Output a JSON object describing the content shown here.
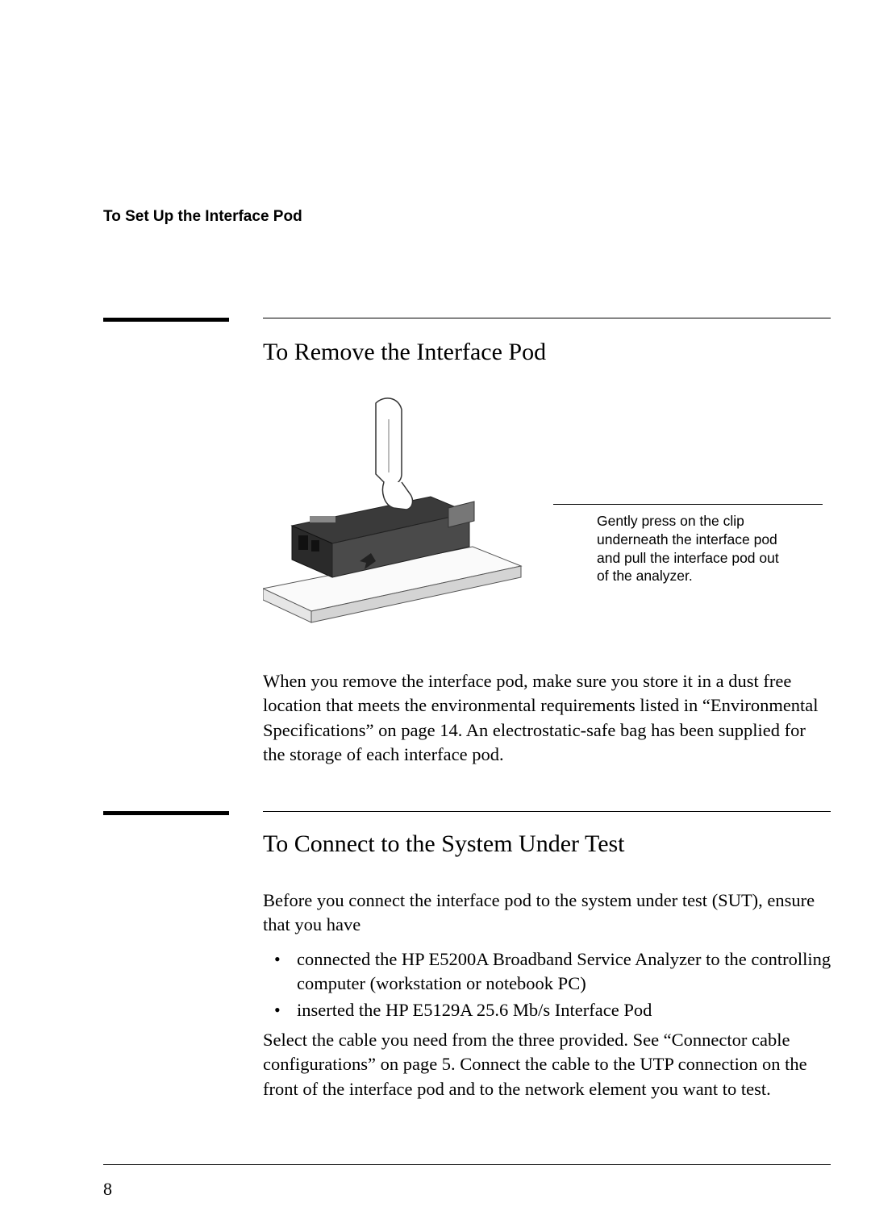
{
  "running_head": "To Set Up the Interface Pod",
  "section1": {
    "heading": "To Remove the Interface Pod",
    "callout": "Gently press on the clip underneath the interface pod and pull the interface pod out of the analyzer.",
    "paragraph": "When you remove the interface pod, make sure you store it in a dust free location that meets the environmental requirements listed in “Environmental Specifications” on page 14. An electrostatic-safe bag has been supplied for the storage of each interface pod."
  },
  "section2": {
    "heading": "To Connect to the System Under Test",
    "intro": "Before you connect the interface pod to the system under test (SUT), ensure that you have",
    "bullets": [
      "connected the HP E5200A Broadband Service Analyzer to the controlling computer (workstation or notebook PC)",
      "inserted the HP E5129A 25.6 Mb/s Interface Pod"
    ],
    "after": "Select the cable you need from the three provided. See “Connector cable configurations” on page 5. Connect the cable to the UTP connection on the front of the interface pod and to the network element you want to test."
  },
  "page_number": "8"
}
